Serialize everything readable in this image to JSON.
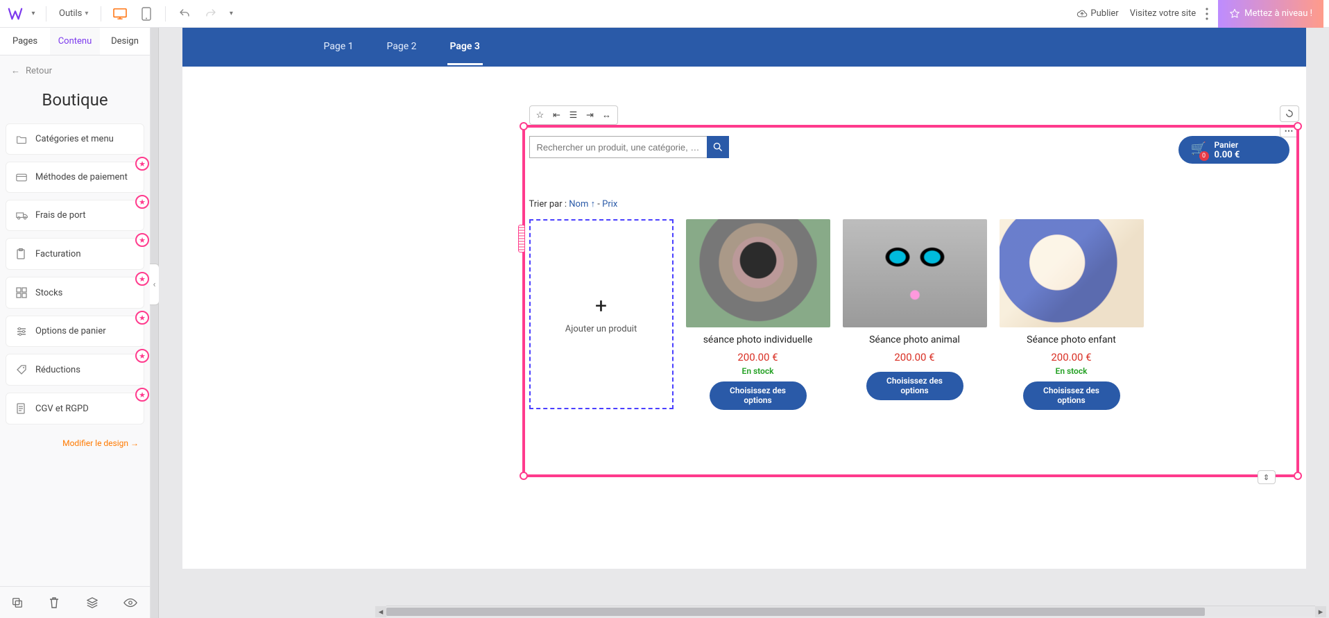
{
  "topbar": {
    "tools_label": "Outils",
    "publish_label": "Publier",
    "visit_label": "Visitez votre site",
    "upgrade_label": "Mettez à niveau !"
  },
  "tabs": {
    "pages": "Pages",
    "content": "Contenu",
    "design": "Design"
  },
  "back_label": "Retour",
  "panel_title": "Boutique",
  "menu": {
    "categories": "Catégories et menu",
    "payment": "Méthodes de paiement",
    "shipping": "Frais de port",
    "billing": "Facturation",
    "stocks": "Stocks",
    "cart_options": "Options de panier",
    "discounts": "Réductions",
    "terms": "CGV et RGPD"
  },
  "modify_design": "Modifier le design →",
  "pages": {
    "p1": "Page 1",
    "p2": "Page 2",
    "p3": "Page 3"
  },
  "search_placeholder": "Rechercher un produit, une catégorie, …",
  "cart": {
    "label": "Panier",
    "total": "0.00 €",
    "count": "0"
  },
  "sort": {
    "prefix": "Trier par : ",
    "name": "Nom ↑",
    "sep": " - ",
    "price": "Prix"
  },
  "add_product": "Ajouter un produit",
  "products": [
    {
      "name": "séance photo individuelle",
      "price": "200.00 €",
      "stock": "En stock",
      "btn": "Choisissez des options"
    },
    {
      "name": "Séance photo animal",
      "price": "200.00 €",
      "stock": "",
      "btn": "Choisissez des options"
    },
    {
      "name": "Séance photo enfant",
      "price": "200.00 €",
      "stock": "En stock",
      "btn": "Choisissez des options"
    }
  ]
}
